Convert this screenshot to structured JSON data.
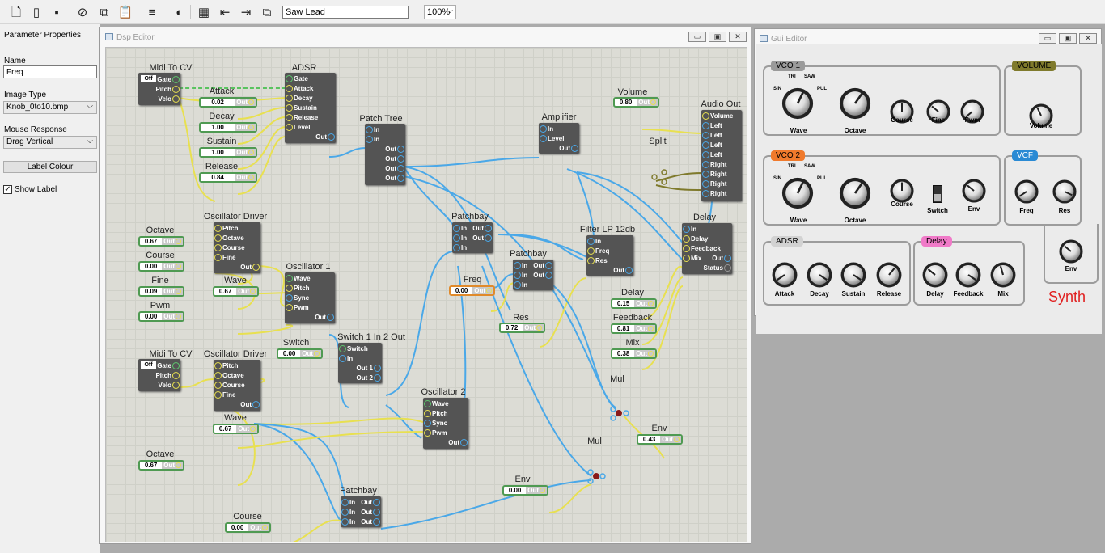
{
  "toolbar": {
    "icons": [
      "new-file-icon",
      "open-file-icon",
      "save-icon",
      "cut-icon",
      "copy-icon",
      "paste-icon",
      "align-icon",
      "audio-icon",
      "grid-icon",
      "import-icon",
      "export-icon",
      "duplicate-icon"
    ],
    "title_value": "Saw Lead",
    "zoom": "100%"
  },
  "properties": {
    "header": "Parameter Properties",
    "name_label": "Name",
    "name_value": "Freq",
    "image_type_label": "Image Type",
    "image_type_value": "Knob_0to10.bmp",
    "mouse_response_label": "Mouse Response",
    "mouse_response_value": "Drag Vertical",
    "label_colour_button": "Label Colour",
    "show_label": "Show Label",
    "show_label_checked": true
  },
  "dsp": {
    "title": "Dsp Editor",
    "modules": {
      "midi1": {
        "title": "Midi To CV",
        "off": "Off",
        "pins": [
          "Gate",
          "Pitch",
          "Velo"
        ]
      },
      "adsr": {
        "title": "ADSR",
        "pins": [
          "Gate",
          "Attack",
          "Decay",
          "Sustain",
          "Release",
          "Level",
          "Out"
        ]
      },
      "patchtree": {
        "title": "Patch Tree",
        "pins": [
          "In",
          "In",
          "Out",
          "Out",
          "Out",
          "Out"
        ]
      },
      "amp": {
        "title": "Amplifier",
        "pins": [
          "In",
          "Level",
          "Out"
        ]
      },
      "audioout": {
        "title": "Audio Out",
        "pins": [
          "Volume",
          "Left",
          "Left",
          "Left",
          "Left",
          "Right",
          "Right",
          "Right",
          "Right"
        ]
      },
      "split": {
        "title": "Split"
      },
      "osc1drv": {
        "title": "Oscillator Driver",
        "pins": [
          "Pitch",
          "Octave",
          "Course",
          "Fine",
          "Out"
        ]
      },
      "osc1": {
        "title": "Oscillator 1",
        "pins": [
          "Wave",
          "Pitch",
          "Sync",
          "Pwm",
          "Out"
        ]
      },
      "patchbay1": {
        "title": "Patchbay",
        "pins": [
          "In",
          "Out",
          "In",
          "Out",
          "In"
        ]
      },
      "patchbay2": {
        "title": "Patchbay",
        "pins": [
          "In",
          "Out",
          "In",
          "Out",
          "In"
        ]
      },
      "filter": {
        "title": "Filter LP 12db",
        "pins": [
          "In",
          "Freq",
          "Res",
          "Out"
        ]
      },
      "delay": {
        "title": "Delay",
        "pins": [
          "In",
          "Delay",
          "Feedback",
          "Mix",
          "Out",
          "Status"
        ]
      },
      "midi2": {
        "title": "Midi To CV",
        "off": "Off",
        "pins": [
          "Gate",
          "Pitch",
          "Velo"
        ]
      },
      "osc2drv": {
        "title": "Oscillator Driver",
        "pins": [
          "Pitch",
          "Octave",
          "Course",
          "Fine",
          "Out"
        ]
      },
      "switch12": {
        "title": "Switch 1 In 2 Out",
        "pins": [
          "Switch",
          "In",
          "Out 1",
          "Out 2"
        ]
      },
      "osc2": {
        "title": "Oscillator 2",
        "pins": [
          "Wave",
          "Pitch",
          "Sync",
          "Pwm",
          "Out"
        ]
      },
      "mul1": {
        "title": "Mul"
      },
      "mul2": {
        "title": "Mul"
      },
      "patchbay3": {
        "title": "Patchbay",
        "pins": [
          "In",
          "Out",
          "In",
          "Out",
          "In",
          "Out"
        ]
      }
    },
    "values": {
      "attack": {
        "label": "Attack",
        "value": "0.02"
      },
      "decay": {
        "label": "Decay",
        "value": "1.00"
      },
      "sustain": {
        "label": "Sustain",
        "value": "1.00"
      },
      "release": {
        "label": "Release",
        "value": "0.84"
      },
      "volume": {
        "label": "Volume",
        "value": "0.80"
      },
      "octave1": {
        "label": "Octave",
        "value": "0.67"
      },
      "course1": {
        "label": "Course",
        "value": "0.00"
      },
      "fine1": {
        "label": "Fine",
        "value": "0.09"
      },
      "wave1": {
        "label": "Wave",
        "value": "0.67"
      },
      "pwm": {
        "label": "Pwm",
        "value": "0.00"
      },
      "freq": {
        "label": "Freq",
        "value": "0.00"
      },
      "res": {
        "label": "Res",
        "value": "0.72"
      },
      "delayv": {
        "label": "Delay",
        "value": "0.15"
      },
      "feedback": {
        "label": "Feedback",
        "value": "0.81"
      },
      "mix": {
        "label": "Mix",
        "value": "0.38"
      },
      "switch": {
        "label": "Switch",
        "value": "0.00"
      },
      "wave2": {
        "label": "Wave",
        "value": "0.67"
      },
      "octave2": {
        "label": "Octave",
        "value": "0.67"
      },
      "env1": {
        "label": "Env",
        "value": "0.43"
      },
      "env2": {
        "label": "Env",
        "value": "0.00"
      },
      "course2": {
        "label": "Course",
        "value": "0.00"
      }
    },
    "out_label": "Out"
  },
  "gui": {
    "title": "Gui Editor",
    "vco1": {
      "tab": "VCO 1",
      "wave": "Wave",
      "octave": "Octave",
      "course": "Course",
      "fine": "Fine",
      "pwm": "Pwm",
      "tri": "TRI",
      "saw": "SAW",
      "sin": "SIN",
      "pul": "PUL"
    },
    "volume": {
      "tab": "VOLUME",
      "knob": "Volume"
    },
    "vco2": {
      "tab": "VCO 2",
      "wave": "Wave",
      "octave": "Octave",
      "course": "Course",
      "switch": "Switch",
      "env": "Env",
      "tri": "TRI",
      "saw": "SAW",
      "sin": "SIN",
      "pul": "PUL"
    },
    "vcf": {
      "tab": "VCF",
      "freq": "Freq",
      "res": "Res",
      "env": "Env"
    },
    "adsr": {
      "tab": "ADSR",
      "attack": "Attack",
      "decay": "Decay",
      "sustain": "Sustain",
      "release": "Release"
    },
    "delay": {
      "tab": "Delay",
      "delay": "Delay",
      "feedback": "Feedback",
      "mix": "Mix"
    },
    "synth_label": "Synth",
    "colors": {
      "vco1": "#9a9a9a",
      "volume": "#7f7a2c",
      "vco2": "#f07a2c",
      "vcf": "#2a8ad4",
      "adsr": "#d2d2d2",
      "delay": "#f07ac8",
      "synth": "#e02020"
    }
  }
}
